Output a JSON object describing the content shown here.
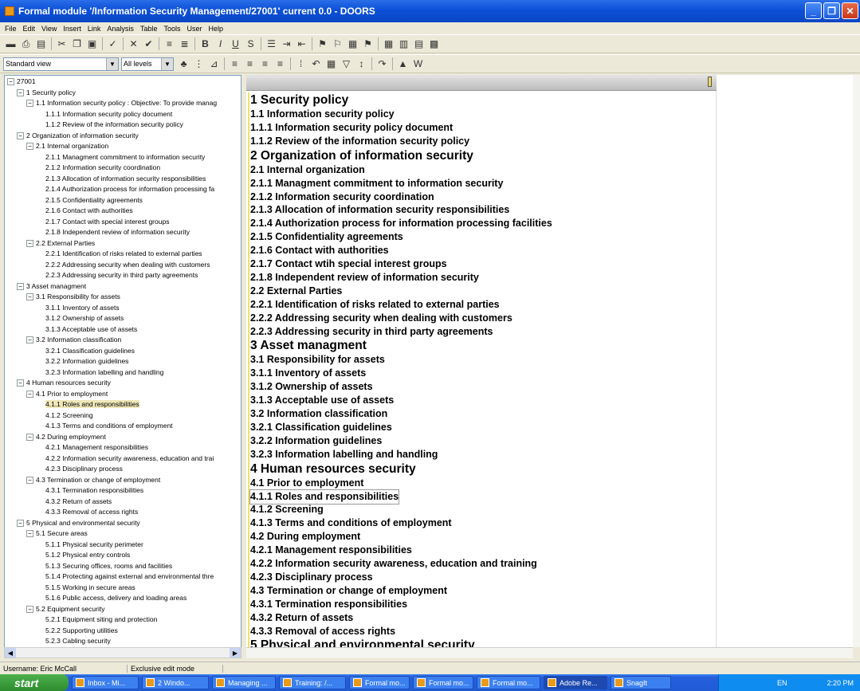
{
  "window": {
    "title": "Formal module '/Information Security Management/27001' current 0.0 - DOORS",
    "min_label": "_",
    "max_label": "❐",
    "close_label": "✕"
  },
  "menu": [
    "File",
    "Edit",
    "View",
    "Insert",
    "Link",
    "Analysis",
    "Table",
    "Tools",
    "User",
    "Help"
  ],
  "toolbar2": {
    "view_select": "Standard view",
    "level_select": "All levels"
  },
  "tree": [
    {
      "label": "27001",
      "level": 0,
      "expander": "−"
    },
    {
      "label": "1 Security policy",
      "level": 1,
      "expander": "−"
    },
    {
      "label": "1.1 Information security policy : Objective: To provide manag",
      "level": 2,
      "expander": "−"
    },
    {
      "label": "1.1.1 Information security policy document",
      "level": 3
    },
    {
      "label": "1.1.2 Review of the information security policy",
      "level": 3
    },
    {
      "label": "2 Organization of information security",
      "level": 1,
      "expander": "−"
    },
    {
      "label": "2.1 Internal organization",
      "level": 2,
      "expander": "−"
    },
    {
      "label": "2.1.1 Managment commitment to information security",
      "level": 3
    },
    {
      "label": "2.1.2 Information security coordination",
      "level": 3
    },
    {
      "label": "2.1.3 Allocation of information security responsibilities",
      "level": 3
    },
    {
      "label": "2.1.4 Authorization process for information processing fa",
      "level": 3
    },
    {
      "label": "2.1.5 Confidentiality agreements",
      "level": 3
    },
    {
      "label": "2.1.6 Contact with authorities",
      "level": 3
    },
    {
      "label": "2.1.7 Contact with special interest groups",
      "level": 3
    },
    {
      "label": "2.1.8 Independent review of information security",
      "level": 3
    },
    {
      "label": "2.2 External Parties",
      "level": 2,
      "expander": "−"
    },
    {
      "label": "2.2.1 Identification of risks related to external parties",
      "level": 3
    },
    {
      "label": "2.2.2 Addressing security when dealing with customers",
      "level": 3
    },
    {
      "label": "2.2.3 Addressing security in third party agreements",
      "level": 3
    },
    {
      "label": "3 Asset managment",
      "level": 1,
      "expander": "−"
    },
    {
      "label": "3.1 Responsibility for assets",
      "level": 2,
      "expander": "−"
    },
    {
      "label": "3.1.1 Inventory of assets",
      "level": 3
    },
    {
      "label": "3.1.2 Ownership of assets",
      "level": 3
    },
    {
      "label": "3.1.3 Acceptable use of assets",
      "level": 3
    },
    {
      "label": "3.2 Information classification",
      "level": 2,
      "expander": "−"
    },
    {
      "label": "3.2.1 Classification guidelines",
      "level": 3
    },
    {
      "label": "3.2.2 Information guidelines",
      "level": 3
    },
    {
      "label": "3.2.3 Information labelling and handling",
      "level": 3
    },
    {
      "label": "4 Human resources security",
      "level": 1,
      "expander": "−"
    },
    {
      "label": "4.1 Prior to employment",
      "level": 2,
      "expander": "−"
    },
    {
      "label": "4.1.1 Roles and responsibilities",
      "level": 3,
      "selected": true
    },
    {
      "label": "4.1.2 Screening",
      "level": 3
    },
    {
      "label": "4.1.3 Terms and conditions of employment",
      "level": 3
    },
    {
      "label": "4.2 During employment",
      "level": 2,
      "expander": "−"
    },
    {
      "label": "4.2.1 Management responsibilities",
      "level": 3
    },
    {
      "label": "4.2.2 Information security awareness, education and trai",
      "level": 3
    },
    {
      "label": "4.2.3 Disciplinary process",
      "level": 3
    },
    {
      "label": "4.3 Termination or change of employment",
      "level": 2,
      "expander": "−"
    },
    {
      "label": "4.3.1 Termination responsibilities",
      "level": 3
    },
    {
      "label": "4.3.2 Return of assets",
      "level": 3
    },
    {
      "label": "4.3.3 Removal of access rights",
      "level": 3
    },
    {
      "label": "5 Physical and environmental security",
      "level": 1,
      "expander": "−"
    },
    {
      "label": "5.1 Secure areas",
      "level": 2,
      "expander": "−"
    },
    {
      "label": "5.1.1 Physical security perimeter",
      "level": 3
    },
    {
      "label": "5.1.2 Physical entry controls",
      "level": 3
    },
    {
      "label": "5.1.3 Securing offices, rooms and facilities",
      "level": 3
    },
    {
      "label": "5.1.4 Protecting against external and environmental thre",
      "level": 3
    },
    {
      "label": "5.1.5 Working in secure areas",
      "level": 3
    },
    {
      "label": "5.1.6 Public access, delivery and loading areas",
      "level": 3
    },
    {
      "label": "5.2 Equipment security",
      "level": 2,
      "expander": "−"
    },
    {
      "label": "5.2.1 Equipment siting and protection",
      "level": 3
    },
    {
      "label": "5.2.2 Supporting utilities",
      "level": 3
    },
    {
      "label": "5.2.3 Cabling security",
      "level": 3
    }
  ],
  "doc": [
    {
      "text": "1 Security policy",
      "h": 1
    },
    {
      "text": "1.1 Information security policy",
      "h": 2
    },
    {
      "text": "1.1.1 Information security policy document",
      "h": 2
    },
    {
      "text": "1.1.2 Review of the information security policy",
      "h": 2
    },
    {
      "text": "2 Organization of information security",
      "h": 1
    },
    {
      "text": "2.1 Internal organization",
      "h": 2
    },
    {
      "text": "2.1.1 Managment commitment to information security",
      "h": 2
    },
    {
      "text": "2.1.2 Information security coordination",
      "h": 2
    },
    {
      "text": "2.1.3 Allocation of information security responsibilities",
      "h": 2
    },
    {
      "text": "2.1.4 Authorization process for information processing facilities",
      "h": 2
    },
    {
      "text": "2.1.5 Confidentiality agreements",
      "h": 2
    },
    {
      "text": "2.1.6 Contact with authorities",
      "h": 2
    },
    {
      "text": "2.1.7 Contact wtih special interest groups",
      "h": 2
    },
    {
      "text": "2.1.8 Independent review of information security",
      "h": 2
    },
    {
      "text": "2.2 External Parties",
      "h": 2
    },
    {
      "text": "2.2.1 Identification of risks related to external parties",
      "h": 2
    },
    {
      "text": "2.2.2 Addressing security when dealing with customers",
      "h": 2
    },
    {
      "text": "2.2.3 Addressing security in third party agreements",
      "h": 2
    },
    {
      "text": "3 Asset managment",
      "h": 1
    },
    {
      "text": "3.1 Responsibility for assets",
      "h": 2
    },
    {
      "text": "3.1.1 Inventory of assets",
      "h": 2
    },
    {
      "text": "3.1.2 Ownership of assets",
      "h": 2
    },
    {
      "text": "3.1.3 Acceptable use of assets",
      "h": 2
    },
    {
      "text": "3.2 Information classification",
      "h": 2
    },
    {
      "text": "3.2.1 Classification guidelines",
      "h": 2
    },
    {
      "text": "3.2.2 Information guidelines",
      "h": 2
    },
    {
      "text": "3.2.3 Information labelling and handling",
      "h": 2
    },
    {
      "text": "4 Human resources security",
      "h": 1
    },
    {
      "text": "4.1 Prior to employment",
      "h": 2
    },
    {
      "text": "4.1.1 Roles and responsibilities",
      "h": 2,
      "selected": true
    },
    {
      "text": "4.1.2 Screening",
      "h": 2
    },
    {
      "text": "4.1.3 Terms and conditions of employment",
      "h": 2
    },
    {
      "text": "4.2 During employment",
      "h": 2
    },
    {
      "text": "4.2.1 Management responsibilities",
      "h": 2
    },
    {
      "text": "4.2.2 Information security awareness, education and training",
      "h": 2
    },
    {
      "text": "4.2.3 Disciplinary process",
      "h": 2
    },
    {
      "text": "4.3 Termination or change of employment",
      "h": 2
    },
    {
      "text": "4.3.1 Termination responsibilities",
      "h": 2
    },
    {
      "text": "4.3.2 Return of assets",
      "h": 2
    },
    {
      "text": "4.3.3 Removal of access rights",
      "h": 2
    },
    {
      "text": "5 Physical and environmental security",
      "h": 1
    }
  ],
  "status": {
    "user": "Username: Eric McCall",
    "mode": "Exclusive edit mode"
  },
  "taskbar": {
    "start": "start",
    "tasks": [
      "Inbox - Mi...",
      "2 Windo...",
      "Managing ...",
      "Training: /...",
      "Formal mo...",
      "Formal mo...",
      "Formal mo...",
      "Adobe Re...",
      "SnagIt"
    ],
    "lang": "EN",
    "time": "2:20 PM"
  },
  "colors": {
    "title_bar": "#0c50d8",
    "selection": "#efe7b8",
    "taskbar": "#245edb"
  }
}
